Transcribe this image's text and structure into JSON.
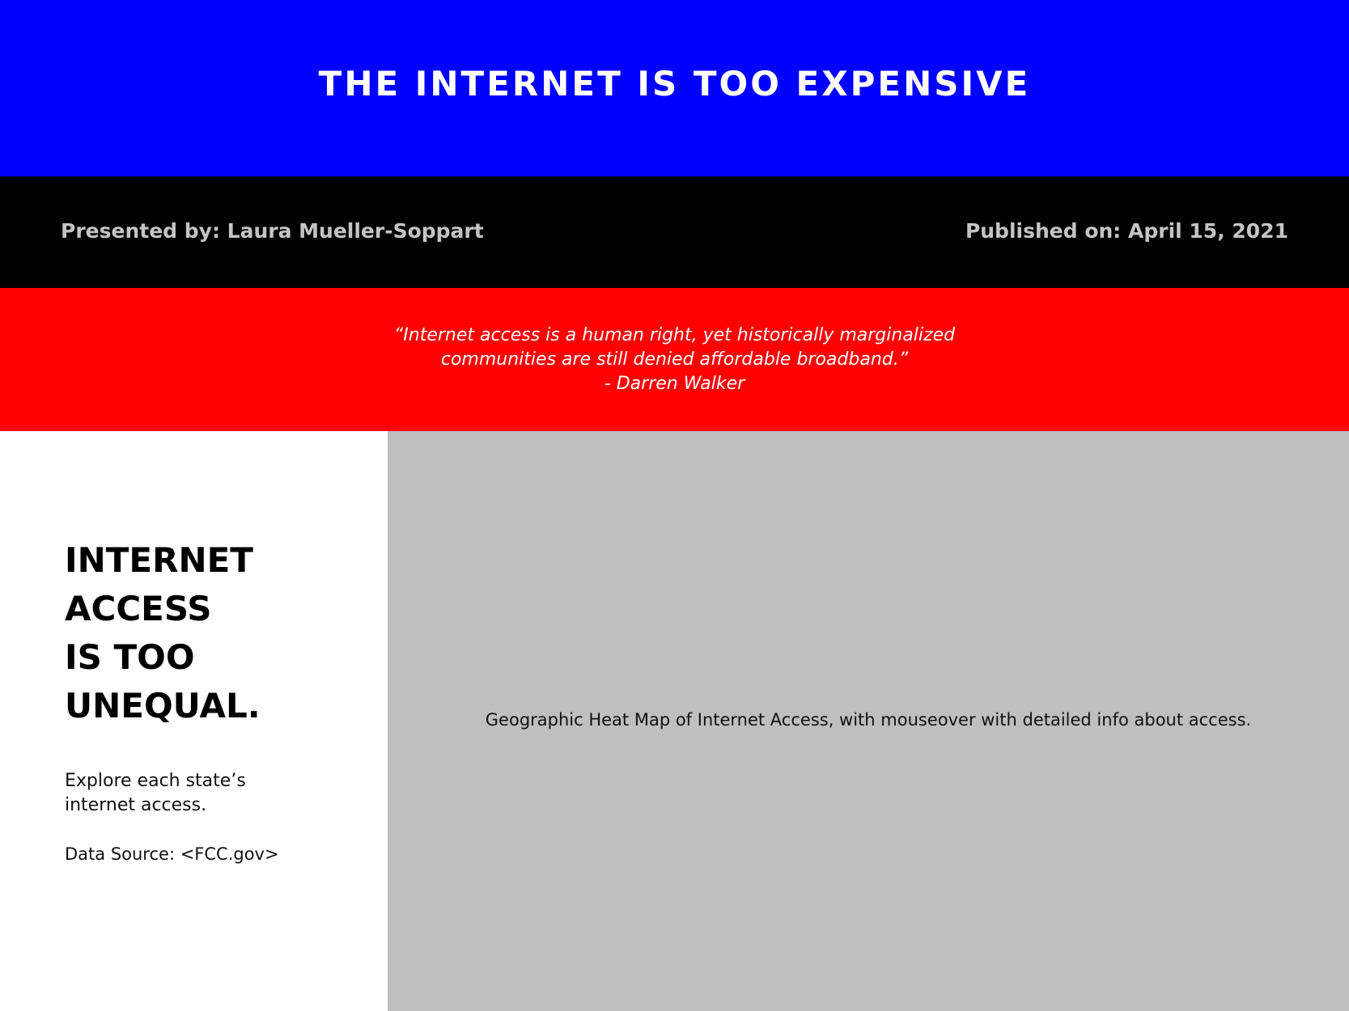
{
  "colors": {
    "banner": "#0000ff",
    "meta_bar": "#000000",
    "meta_text": "#c4c4c4",
    "quote_bar": "#ff0000",
    "map_placeholder": "#bfbfbf"
  },
  "header": {
    "title": "THE INTERNET IS TOO EXPENSIVE"
  },
  "meta": {
    "presenter": "Presented by: Laura Mueller-Soppart",
    "published": "Published on: April 15, 2021"
  },
  "quote": {
    "line1": "“Internet access is a human right, yet historically marginalized",
    "line2": "communities are still denied affordable broadband.”",
    "attribution": "- Darren Walker"
  },
  "sidebar": {
    "headline_lines": [
      "INTERNET",
      "ACCESS",
      "IS TOO",
      "UNEQUAL."
    ],
    "explore_line1": "Explore each state’s",
    "explore_line2": "internet access.",
    "source": "Data Source: <FCC.gov>"
  },
  "map": {
    "caption": "Geographic Heat Map of Internet Access, with mouseover with detailed info about access."
  }
}
